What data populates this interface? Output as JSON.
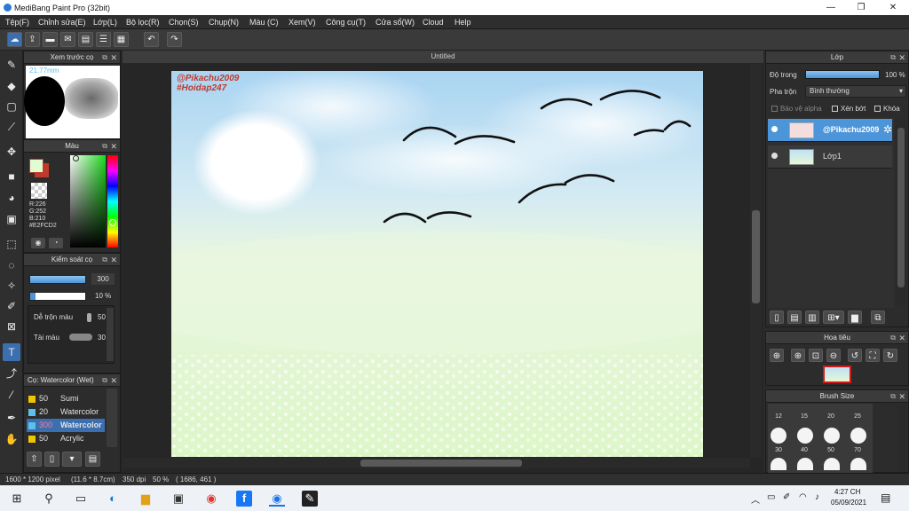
{
  "window": {
    "title": "MediBang Paint Pro (32bit)",
    "min": "—",
    "max": "❐",
    "close": "✕"
  },
  "menu": [
    "Tệp(F)",
    "Chỉnh sửa(E)",
    "Lớp(L)",
    "Bộ lọc(R)",
    "Chọn(S)",
    "Chụp(N)",
    "Màu (C)",
    "Xem(V)",
    "Công cụ(T)",
    "Cửa sổ(W)",
    "Cloud",
    "Help"
  ],
  "canvas": {
    "tab_title": "Untitled",
    "watermark_line1": "@Pikachu2009",
    "watermark_line2": "#Hoidap247"
  },
  "brush_preview": {
    "title": "Xem trước cọ",
    "size": "21.77mm"
  },
  "color_panel": {
    "title": "Màu",
    "r": "R:226",
    "g": "G:252",
    "b": "B:210",
    "hex": "#E2FCD2",
    "current_color": "#e2fcd2",
    "secondary_color": "#c0392b"
  },
  "brush_control": {
    "title": "Kiểm soát cọ",
    "size_value": "300",
    "opacity_value": "10 %",
    "blend_label": "Dễ trộn màu",
    "blend_value": "50",
    "amount_label": "Tài màu",
    "amount_value": "30"
  },
  "brush_list": {
    "title": "Cọ: Watercolor (Wet)",
    "items": [
      {
        "size": "50",
        "name": "Sumi",
        "color": "#f0c600"
      },
      {
        "size": "20",
        "name": "Watercolor",
        "color": "#5bc0eb"
      },
      {
        "size": "300",
        "name": "Watercolor",
        "color": "#5bc0eb"
      },
      {
        "size": "50",
        "name": "Acrylic",
        "color": "#f0c600"
      }
    ]
  },
  "layer_panel": {
    "title": "Lớp",
    "opacity_label": "Độ trong",
    "opacity_value": "100 %",
    "opacity": 1.0,
    "blend_label": "Pha trộn",
    "blend_value": "Bình thường",
    "protect_alpha": "Bảo vệ alpha",
    "clipping": "Xén bớt",
    "lock": "Khóa",
    "layers": [
      {
        "name": "@Pikachu2009",
        "selected": true
      },
      {
        "name": "Lớp1",
        "selected": false
      }
    ]
  },
  "navigator": {
    "title": "Hoa tiêu"
  },
  "brush_size": {
    "title": "Brush Size",
    "row1": [
      "12",
      "15",
      "20",
      "25"
    ],
    "row2": [
      "30",
      "40",
      "50",
      "70"
    ]
  },
  "status": {
    "dimensions": "1600 * 1200 pixel",
    "physical": "(11.6 * 8.7cm)",
    "dpi": "350 dpi",
    "zoom": "50 %",
    "coords": "( 1686, 461 )"
  },
  "taskbar": {
    "time": "4:27 CH",
    "date": "05/09/2021"
  }
}
